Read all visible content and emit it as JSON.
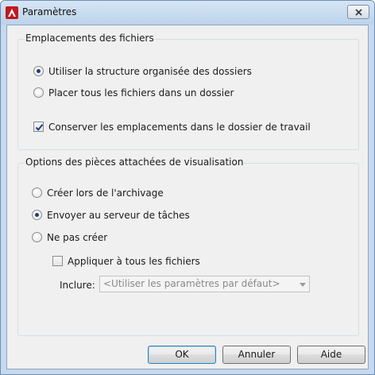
{
  "window": {
    "title": "Paramètres"
  },
  "group_files": {
    "title": "Emplacements des fichiers",
    "options": [
      {
        "label": "Utiliser la structure organisée des dossiers",
        "selected": true
      },
      {
        "label": "Placer tous les fichiers dans un dossier",
        "selected": false
      }
    ],
    "keep_locations": {
      "label": "Conserver les emplacements dans le dossier de travail",
      "checked": true
    }
  },
  "group_visual": {
    "title": "Options des pièces attachées de visualisation",
    "options": [
      {
        "label": "Créer lors de l'archivage",
        "selected": false
      },
      {
        "label": "Envoyer au serveur de tâches",
        "selected": true
      },
      {
        "label": "Ne pas créer",
        "selected": false
      }
    ],
    "apply_all": {
      "label": "Appliquer à tous les fichiers",
      "checked": false
    },
    "include": {
      "label": "Inclure:",
      "value": "<Utiliser les paramètres par défaut>"
    }
  },
  "buttons": {
    "ok": "OK",
    "cancel": "Annuler",
    "help": "Aide"
  },
  "colors": {
    "app_icon": "#c0181d",
    "radio_dot": "#1f3d7a"
  },
  "icons": {
    "app": "autocad-a-icon",
    "close": "close-x-icon",
    "dropdown": "chevron-down-icon"
  }
}
